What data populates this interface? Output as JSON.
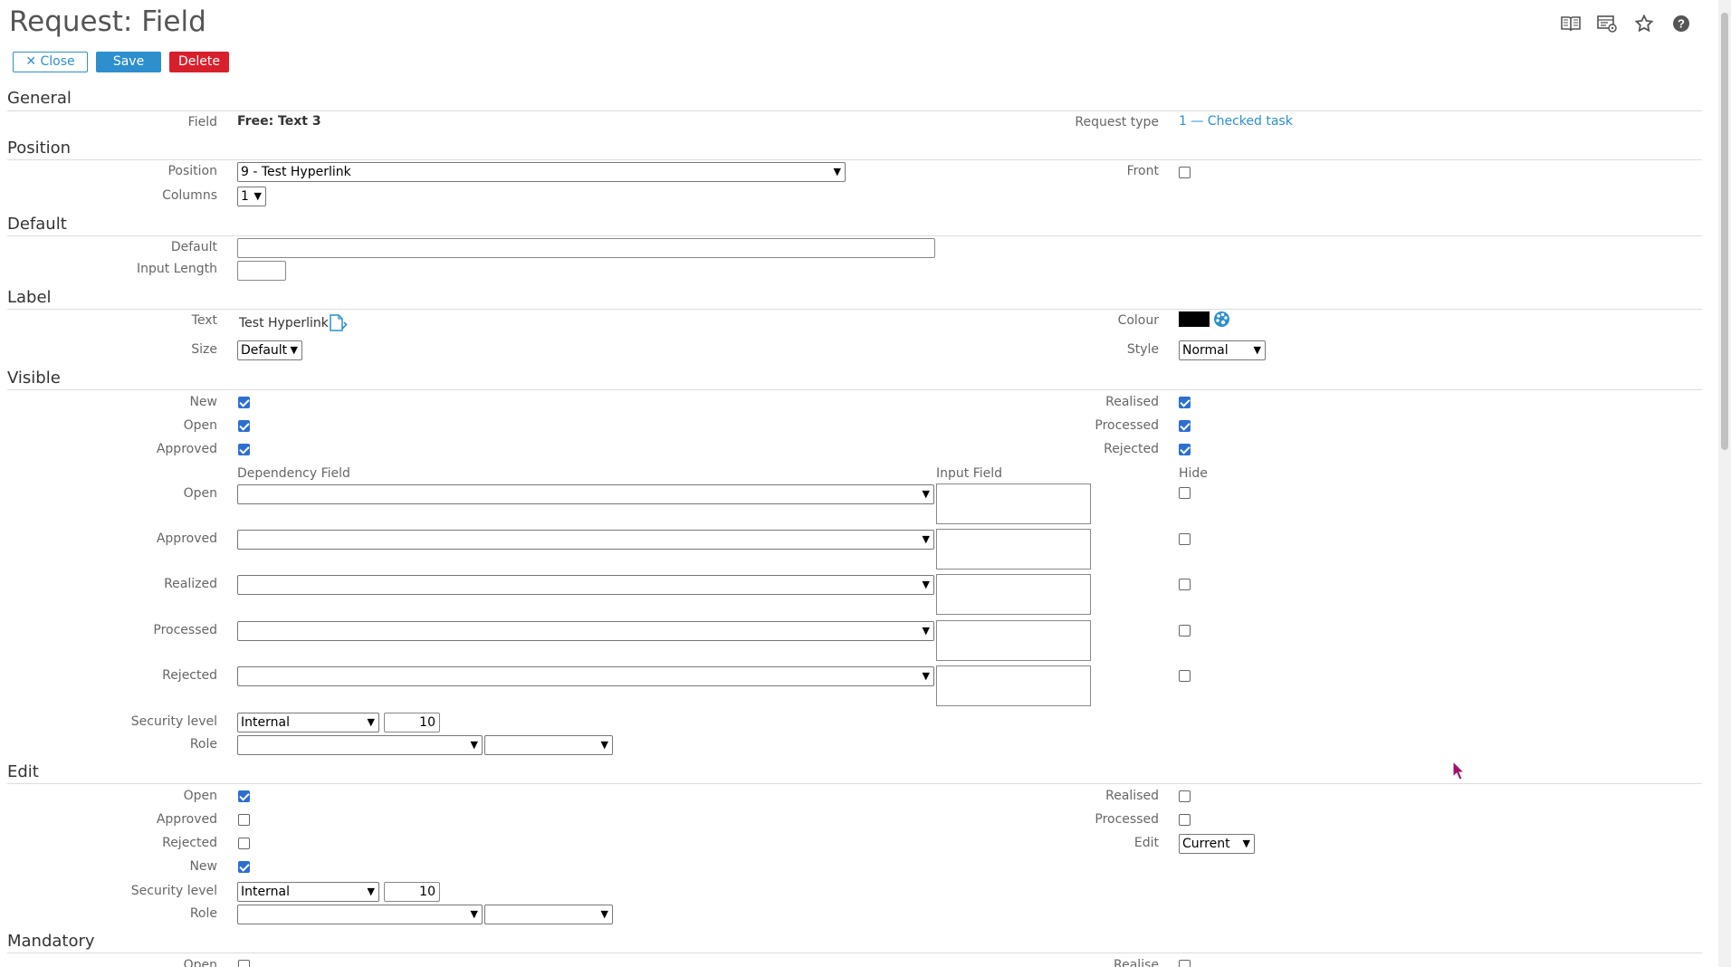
{
  "header": {
    "title": "Request: Field",
    "close_label": "Close",
    "save_label": "Save",
    "delete_label": "Delete"
  },
  "top_icons": [
    "book-icon",
    "screen-settings-icon",
    "star-icon",
    "help-icon"
  ],
  "general": {
    "heading": "General",
    "field_label": "Field",
    "field_value": "Free: Text 3",
    "request_type_label": "Request type",
    "request_type_value": "1 — Checked task"
  },
  "position": {
    "heading": "Position",
    "position_label": "Position",
    "position_value": "9 - Test Hyperlink",
    "columns_label": "Columns",
    "columns_value": "1",
    "front_label": "Front",
    "front_checked": false
  },
  "default": {
    "heading": "Default",
    "default_label": "Default",
    "default_value": "",
    "input_length_label": "Input Length",
    "input_length_value": ""
  },
  "label": {
    "heading": "Label",
    "text_label": "Text",
    "text_value": "Test Hyperlink",
    "size_label": "Size",
    "size_value": "Default",
    "colour_label": "Colour",
    "colour_value": "#000000",
    "style_label": "Style",
    "style_value": "Normal"
  },
  "visible": {
    "heading": "Visible",
    "new_label": "New",
    "open_label": "Open",
    "approved_label": "Approved",
    "realised_label": "Realised",
    "processed_label": "Processed",
    "rejected_label": "Rejected",
    "checks": {
      "new": true,
      "open": true,
      "approved": true,
      "realised": true,
      "processed": true,
      "rejected": true
    },
    "dep_header": "Dependency Field",
    "input_header": "Input Field",
    "hide_header": "Hide",
    "dep_rows": [
      {
        "label": "Open",
        "value": "",
        "hide": false
      },
      {
        "label": "Approved",
        "value": "",
        "hide": false
      },
      {
        "label": "Realized",
        "value": "",
        "hide": false
      },
      {
        "label": "Processed",
        "value": "",
        "hide": false
      },
      {
        "label": "Rejected",
        "value": "",
        "hide": false
      }
    ],
    "security_label": "Security level",
    "security_value": "Internal",
    "security_num": "10",
    "role_label": "Role",
    "role_value": "",
    "role_value2": ""
  },
  "edit": {
    "heading": "Edit",
    "open_label": "Open",
    "approved_label": "Approved",
    "rejected_label": "Rejected",
    "new_label": "New",
    "realised_label": "Realised",
    "processed_label": "Processed",
    "edit_label": "Edit",
    "edit_value": "Current",
    "checks": {
      "open": true,
      "approved": false,
      "rejected": false,
      "new": true,
      "realised": false,
      "processed": false
    },
    "security_label": "Security level",
    "security_value": "Internal",
    "security_num": "10",
    "role_label": "Role",
    "role_value": "",
    "role_value2": ""
  },
  "mandatory": {
    "heading": "Mandatory",
    "open_label": "Open",
    "realise_label": "Realise"
  }
}
